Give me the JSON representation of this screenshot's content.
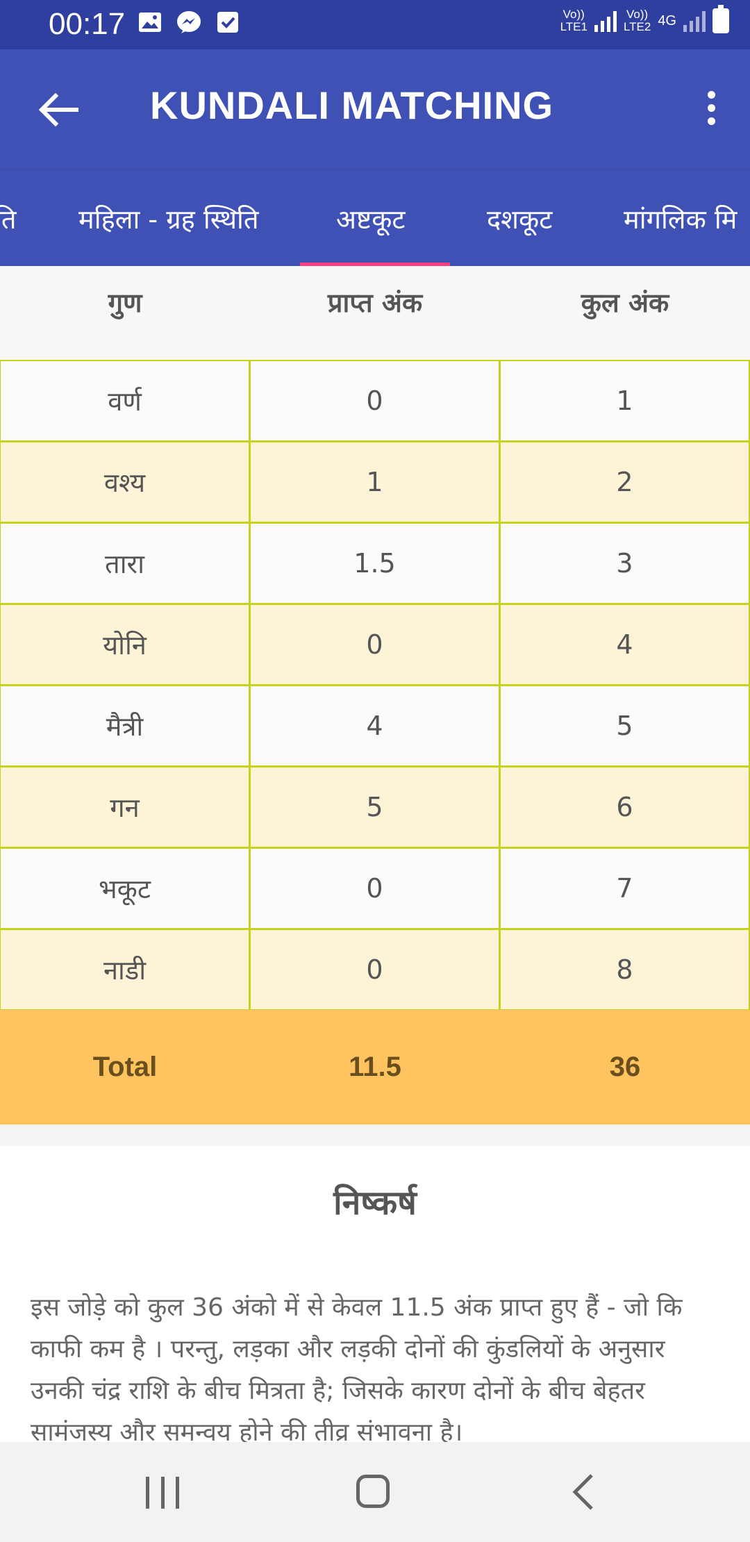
{
  "status_bar": {
    "time": "00:17",
    "sim1": "Vo))\nLTE1",
    "sim2": "Vo))\nLTE2",
    "network": "4G"
  },
  "app_bar": {
    "title": "KUNDALI MATCHING"
  },
  "tabs": [
    {
      "label": "ति"
    },
    {
      "label": "महिला - ग्रह स्थिति"
    },
    {
      "label": "अष्टकूट",
      "selected": true
    },
    {
      "label": "दशकूट"
    },
    {
      "label": "मांगलिक मि"
    }
  ],
  "table": {
    "headers": [
      "गुण",
      "प्राप्त अंक",
      "कुल अंक"
    ],
    "rows": [
      [
        "वर्ण",
        "0",
        "1"
      ],
      [
        "वश्य",
        "1",
        "2"
      ],
      [
        "तारा",
        "1.5",
        "3"
      ],
      [
        "योनि",
        "0",
        "4"
      ],
      [
        "मैत्री",
        "4",
        "5"
      ],
      [
        "गन",
        "5",
        "6"
      ],
      [
        "भकूट",
        "0",
        "7"
      ],
      [
        "नाडी",
        "0",
        "8"
      ]
    ],
    "total": [
      "Total",
      "11.5",
      "36"
    ]
  },
  "conclusion": {
    "title": "निष्कर्ष",
    "text": "इस जोड़े को कुल 36 अंको में से केवल 11.5 अंक प्राप्त हुए हैं  - जो कि काफी कम है । परन्तु, लड़का और लड़की दोनों की कुंडलियों के अनुसार उनकी चंद्र राशि के बीच मित्रता है; जिसके कारण दोनों के बीच बेहतर सामंजस्य और समन्वय होने की तीव्र संभावना है।"
  },
  "colors": {
    "status_bar": "#2f3fa0",
    "app_bar": "#3f51b5",
    "tab_indicator": "#ff4081",
    "row_alt": "#fdf4d8",
    "grid_border": "#c6d21b",
    "total_bg": "#ffc45f"
  }
}
